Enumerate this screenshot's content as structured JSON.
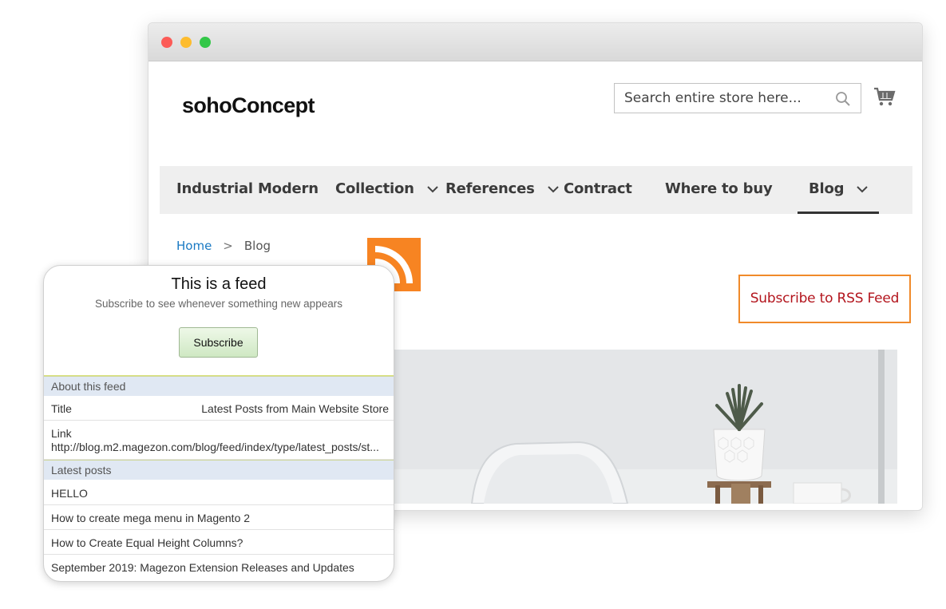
{
  "store": {
    "logo_text": "sohoConcept",
    "search_placeholder": "Search entire store here...",
    "nav": [
      {
        "label": "Industrial Modern",
        "has_dropdown": false
      },
      {
        "label": "Collection",
        "has_dropdown": true
      },
      {
        "label": "References",
        "has_dropdown": true
      },
      {
        "label": "Contract",
        "has_dropdown": false
      },
      {
        "label": "Where to buy",
        "has_dropdown": false
      },
      {
        "label": "Blog",
        "has_dropdown": true,
        "active": true
      }
    ],
    "breadcrumb": {
      "home": "Home",
      "separator": ">",
      "current": "Blog"
    },
    "rss_subscribe_label": "Subscribe to RSS Feed"
  },
  "feed": {
    "title": "This is a feed",
    "subtitle": "Subscribe to see whenever something new appears",
    "subscribe_label": "Subscribe",
    "about_heading": "About this feed",
    "title_label": "Title",
    "title_value": "Latest Posts from Main Website Store",
    "link_label": "Link",
    "link_value": "http://blog.m2.magezon.com/blog/feed/index/type/latest_posts/st...",
    "latest_heading": "Latest posts",
    "posts": [
      "HELLO",
      "How to create mega menu in Magento 2",
      "How to Create Equal Height Columns?",
      "September 2019: Magezon Extension Releases and Updates"
    ]
  },
  "colors": {
    "rss_orange": "#f78422",
    "link_blue": "#1979c3",
    "subscribe_red": "#b3151d",
    "nav_bg": "#efefef"
  },
  "icons": [
    "search-icon",
    "cart-icon",
    "chevron-down-icon",
    "rss-icon"
  ]
}
